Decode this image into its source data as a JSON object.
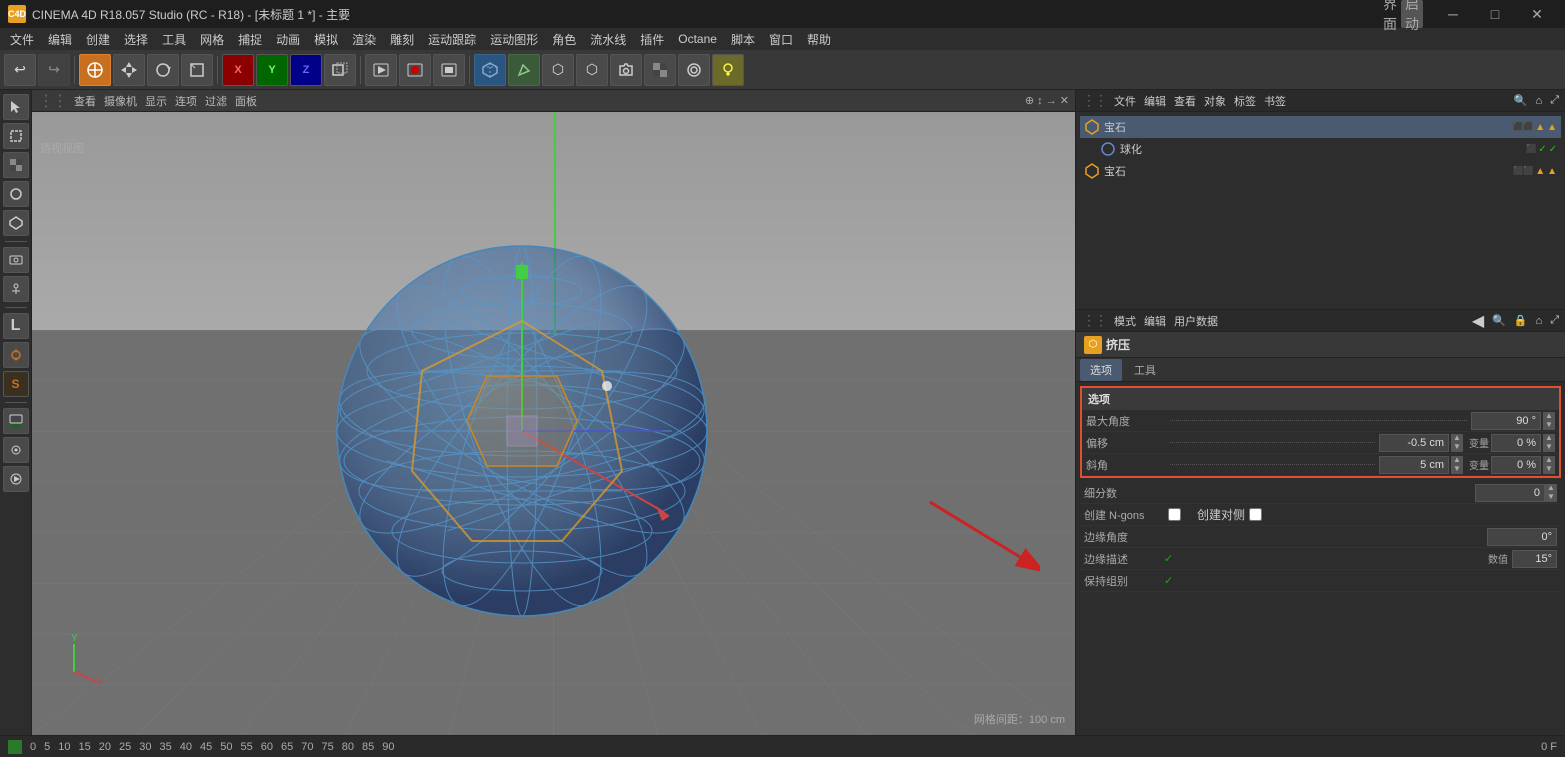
{
  "titlebar": {
    "title": "CINEMA 4D R18.057 Studio (RC - R18) - [未标题 1 *] - 主要",
    "app_name": "CINEMA 4D",
    "interface_label": "界面",
    "layout_label": "启动",
    "win_minimize": "─",
    "win_maximize": "□",
    "win_close": "✕"
  },
  "menubar": {
    "items": [
      "文件",
      "编辑",
      "创建",
      "选择",
      "工具",
      "网格",
      "捕捉",
      "动画",
      "模拟",
      "渲染",
      "雕刻",
      "运动跟踪",
      "运动图形",
      "角色",
      "流水线",
      "插件",
      "Octane",
      "脚本",
      "窗口",
      "帮助"
    ]
  },
  "toolbar": {
    "buttons": [
      "↩",
      "▷",
      "●",
      "⬛",
      "⊕",
      "✕",
      "◎",
      "↻",
      "Y",
      "Z",
      "⬡",
      "▶",
      "⏸",
      "⏹",
      "⏺",
      "⬡",
      "✏",
      "⬡",
      "⬡",
      "⬡",
      "⬡",
      "⬡",
      "💡"
    ]
  },
  "viewport": {
    "toolbar_items": [
      "查看",
      "摄像机",
      "显示",
      "连项",
      "过滤",
      "面板"
    ],
    "label": "透视视图",
    "bottom_label": "网格间距：100 cm",
    "move_icon": "⊕↕→"
  },
  "left_toolbar": {
    "buttons": [
      "□",
      "⬡",
      "◈",
      "⬡",
      "⬡",
      "⬡",
      "⬡",
      "⬡",
      "L",
      "⊕",
      "S",
      "⬡",
      "⬡",
      "⬡"
    ]
  },
  "scene_panel": {
    "toolbar_items": [
      "文件",
      "编辑",
      "查看",
      "对象",
      "标签",
      "书签"
    ],
    "objects": [
      {
        "name": "宝石",
        "type": "gem",
        "indent": 0,
        "controls": [
          "checker",
          "triangle-orange",
          "triangle-orange"
        ],
        "selected": true
      },
      {
        "name": "球化",
        "type": "sphere-deformer",
        "indent": 1,
        "controls": [
          "checker",
          "checkmark",
          "checkmark"
        ],
        "selected": false
      },
      {
        "name": "宝石",
        "type": "gem2",
        "indent": 0,
        "controls": [
          "checker",
          "triangle-orange",
          "triangle-orange"
        ],
        "selected": false
      }
    ]
  },
  "attr_panel": {
    "toolbar_items": [
      "模式",
      "编辑",
      "用户数据"
    ],
    "object_name": "挤压",
    "tabs": [
      "选项",
      "工具"
    ],
    "active_tab": "选项",
    "section_title": "选项",
    "fields": [
      {
        "label": "最大角度",
        "dots": true,
        "value": "90 °",
        "has_spinner": true,
        "extra": null
      },
      {
        "label": "偏移",
        "dots": true,
        "value": "-0.5 cm",
        "has_spinner": true,
        "extra_label": "变量",
        "extra_value": "0 %",
        "extra_spinner": true
      },
      {
        "label": "斜角",
        "dots": true,
        "value": "5 cm",
        "has_spinner": true,
        "extra_label": "变量",
        "extra_value": "0 %",
        "extra_spinner": true
      }
    ],
    "extra_fields": [
      {
        "label": "细分数",
        "value": "0",
        "has_spinner": true
      },
      {
        "label": "创建 N-gons",
        "type": "checkbox",
        "checked": false
      },
      {
        "label": "创建对侧",
        "type": "checkbox",
        "checked": false
      },
      {
        "label": "边缘角度",
        "value": "0°",
        "has_spinner": false
      },
      {
        "label": "边缘描述",
        "value": "✓",
        "extra_label": "数值",
        "extra_value": "15°"
      },
      {
        "label": "保持组别",
        "value": "✓"
      }
    ]
  },
  "statusbar": {
    "grid_label": "网格间距：100 cm"
  },
  "timeline": {
    "start": "0",
    "frame_label": "0 F",
    "markers": [
      "0",
      "5",
      "10",
      "15",
      "20",
      "25",
      "30",
      "35",
      "40",
      "45",
      "50",
      "55",
      "60",
      "65",
      "70",
      "75",
      "80",
      "85",
      "90"
    ]
  },
  "colors": {
    "accent_orange": "#e8a020",
    "accent_red": "#e03020",
    "accent_green": "#20c020",
    "accent_blue": "#2060e0",
    "highlight_box": "#e03020",
    "bg_dark": "#2d2d2d",
    "bg_mid": "#383838",
    "bg_viewport": "#5a5a5a"
  }
}
